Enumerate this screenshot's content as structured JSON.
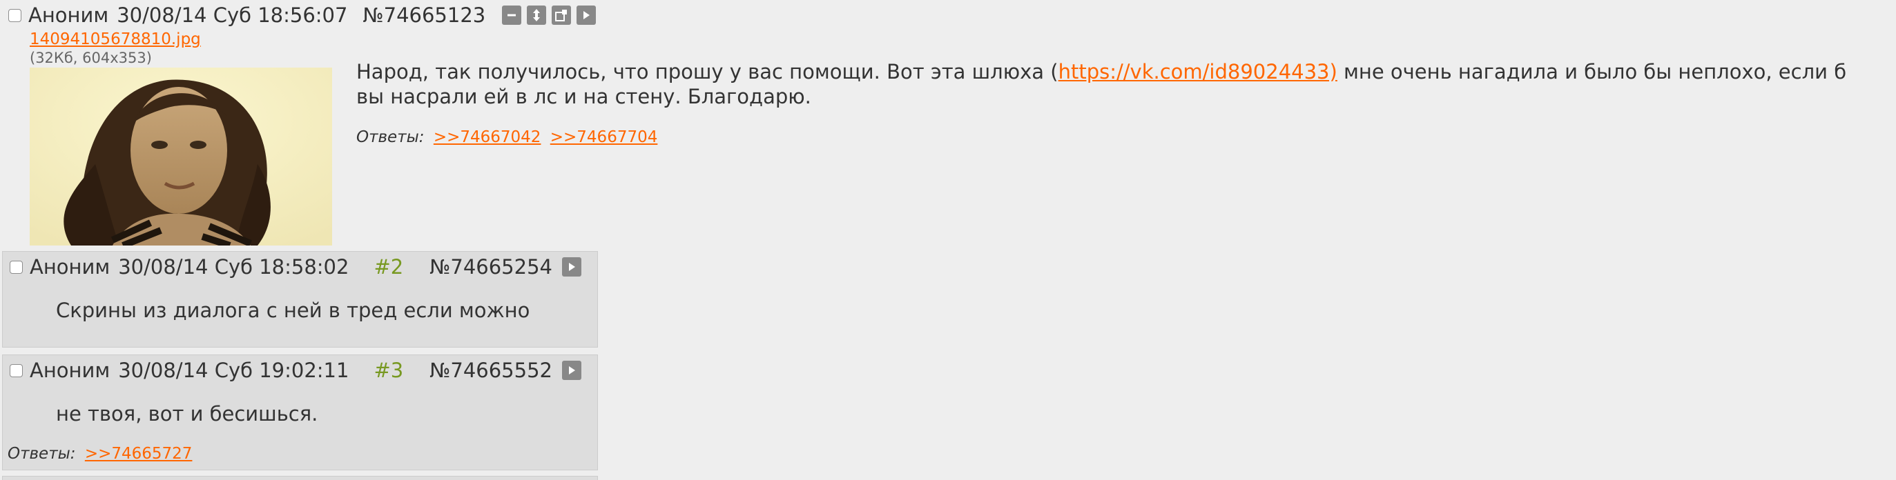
{
  "op": {
    "author": "Аноним",
    "date": "30/08/14 Суб 18:56:07",
    "post_number": "№74665123",
    "file": {
      "name": "14094105678810.jpg",
      "info": "(32Кб, 604x353)"
    },
    "message_before_link": "Народ, так получилось, что прошу у вас помощи. Вот эта шлюха (",
    "message_link": "https://vk.com/id89024433)",
    "message_after_link": " мне очень нагадила и было бы неплохо, если б вы насрали ей в лс и на стену. Благодарю.",
    "replies_label": "Ответы:",
    "replies": [
      ">>74667042",
      ">>74667704"
    ],
    "tool_icons": [
      "minus-icon",
      "expand-vertical-icon",
      "new-window-icon",
      "play-icon"
    ]
  },
  "posts": [
    {
      "author": "Аноним",
      "date": "30/08/14 Суб 18:58:02",
      "index": "#2",
      "post_number": "№74665254",
      "message": "Скрины из диалога с ней в тред если можно"
    },
    {
      "author": "Аноним",
      "date": "30/08/14 Суб 19:02:11",
      "index": "#3",
      "post_number": "№74665552",
      "message": "не твоя, вот и бесишься.",
      "replies_label": "Ответы:",
      "replies": [
        ">>74665727"
      ]
    }
  ],
  "colors": {
    "background": "#eeeeee",
    "reply_background": "#dddddd",
    "link": "#ff6600",
    "post_index": "#789922",
    "tool_button": "#888888"
  }
}
